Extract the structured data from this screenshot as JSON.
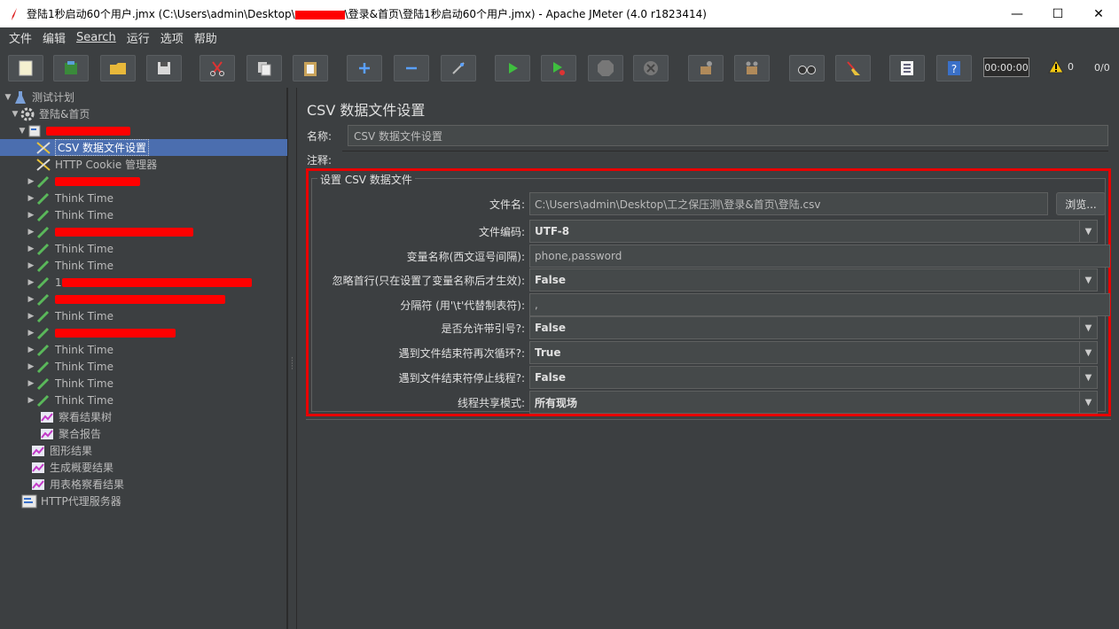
{
  "window": {
    "title_before": "登陆1秒启动60个用户.jmx (C:\\Users\\admin\\Desktop\\",
    "title_after": "\\登录&首页\\登陆1秒启动60个用户.jmx) - Apache JMeter (4.0 r1823414)",
    "buttons": {
      "minimize": "—",
      "maximize": "☐",
      "close": "✕"
    }
  },
  "menu": [
    "文件",
    "编辑",
    "Search",
    "运行",
    "选项",
    "帮助"
  ],
  "toolbar": {
    "timer": "00:00:00",
    "warnings": "0",
    "threads": "0/0"
  },
  "tree": {
    "items": [
      {
        "label": "测试计划"
      },
      {
        "label": "登陆&首页"
      },
      {
        "label": ""
      },
      {
        "label": "CSV 数据文件设置"
      },
      {
        "label": "HTTP Cookie 管理器"
      },
      {
        "label": ""
      },
      {
        "label": "Think Time"
      },
      {
        "label": "Think Time"
      },
      {
        "label": ""
      },
      {
        "label": "Think Time"
      },
      {
        "label": "Think Time"
      },
      {
        "label": "1"
      },
      {
        "label": ""
      },
      {
        "label": "Think Time"
      },
      {
        "label": ""
      },
      {
        "label": "Think Time"
      },
      {
        "label": "Think Time"
      },
      {
        "label": "Think Time"
      },
      {
        "label": "Think Time"
      },
      {
        "label": "察看结果树"
      },
      {
        "label": "聚合报告"
      },
      {
        "label": "图形结果"
      },
      {
        "label": "生成概要结果"
      },
      {
        "label": "用表格察看结果"
      },
      {
        "label": "HTTP代理服务器"
      }
    ]
  },
  "panel": {
    "title": "CSV 数据文件设置",
    "name_label": "名称:",
    "name_value": "CSV 数据文件设置",
    "comment_label": "注释:",
    "group_title": "设置 CSV 数据文件",
    "browse_label": "浏览...",
    "fields": [
      {
        "label": "文件名:",
        "value": "C:\\Users\\admin\\Desktop\\工之保压测\\登录&首页\\登陆.csv"
      },
      {
        "label": "文件编码:",
        "value": "UTF-8"
      },
      {
        "label": "变量名称(西文逗号间隔):",
        "value": "phone,password"
      },
      {
        "label": "忽略首行(只在设置了变量名称后才生效):",
        "value": "False"
      },
      {
        "label": "分隔符 (用'\\t'代替制表符):",
        "value": ","
      },
      {
        "label": "是否允许带引号?:",
        "value": "False"
      },
      {
        "label": "遇到文件结束符再次循环?:",
        "value": "True"
      },
      {
        "label": "遇到文件结束符停止线程?:",
        "value": "False"
      },
      {
        "label": "线程共享模式:",
        "value": "所有现场"
      }
    ]
  },
  "colors": {
    "background": "#3c3f41",
    "selection": "#4b6eaf",
    "highlight_border": "#e80000",
    "redaction": "#ff0000"
  }
}
